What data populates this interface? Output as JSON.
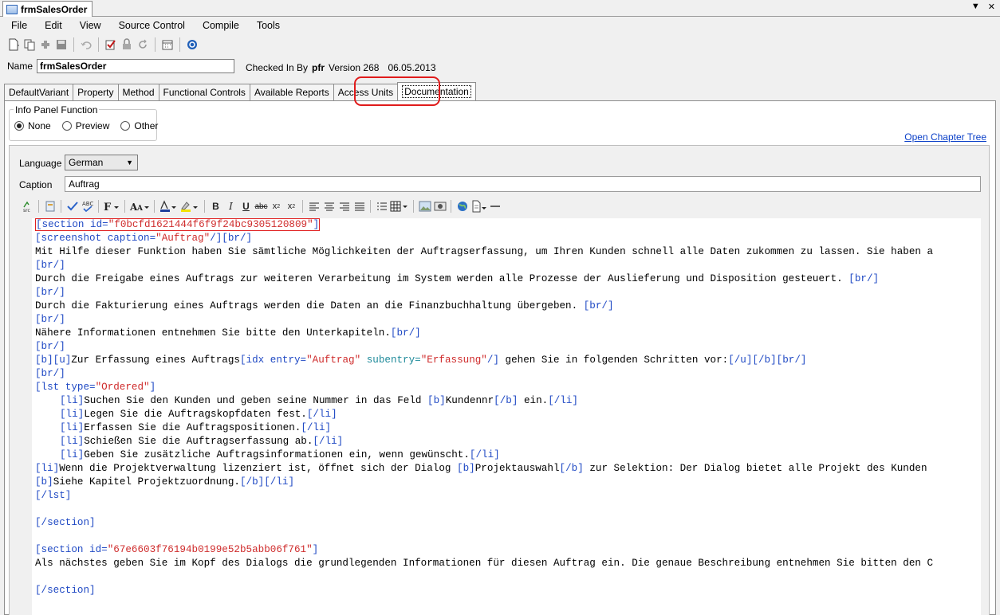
{
  "window": {
    "doc_tab": "frmSalesOrder",
    "tab_dropdown": "▼",
    "tab_close": "✕"
  },
  "menu": [
    "File",
    "Edit",
    "View",
    "Source Control",
    "Compile",
    "Tools"
  ],
  "name_row": {
    "label": "Name",
    "value": "frmSalesOrder",
    "checked_in_by": "Checked In By",
    "user": "pfr",
    "version": "Version 268",
    "date": "06.05.2013"
  },
  "tabs": [
    "DefaultVariant",
    "Property",
    "Method",
    "Functional Controls",
    "Available Reports",
    "Access Units",
    "Documentation"
  ],
  "info_panel": {
    "legend": "Info Panel Function",
    "options": [
      "None",
      "Preview",
      "Other"
    ],
    "selected": "None"
  },
  "open_chapter_tree": "Open Chapter Tree",
  "editor": {
    "language_label": "Language",
    "language_value": "German",
    "caption_label": "Caption",
    "caption_value": "Auftrag"
  },
  "code": {
    "l1a": "[section id=",
    "l1b": "\"f0bcfd1621444f6f9f24bc9305120809\"",
    "l1c": "]",
    "l2a": "[screenshot caption=",
    "l2b": "\"Auftrag\"",
    "l2c": "/][br/]",
    "l3": "Mit Hilfe dieser Funktion haben Sie sämtliche Möglichkeiten der Auftragserfassung, um Ihren Kunden schnell alle Daten zukommen zu lassen. Sie haben a",
    "br": "[br/]",
    "l5a": "Durch die Freigabe eines Auftrags zur weiteren Verarbeitung im System werden alle Prozesse der Auslieferung und Disposition gesteuert. ",
    "l7a": "Durch die Fakturierung eines Auftrags werden die Daten an die Finanzbuchhaltung übergeben. ",
    "l9a": "Nähere Informationen entnehmen Sie bitte den Unterkapiteln.",
    "l11a": "[b][u]",
    "l11b": "Zur Erfassung eines Auftrags",
    "l11c": "[idx entry=",
    "l11d": "\"Auftrag\"",
    "l11e": " subentry=",
    "l11f": "\"Erfassung\"",
    "l11g": "/]",
    "l11h": " gehen Sie in folgenden Schritten vor:",
    "l11i": "[/u][/b][br/]",
    "l13a": "[lst type=",
    "l13b": "\"Ordered\"",
    "l13c": "]",
    "li": "[li]",
    "eli": "[/li]",
    "bo": "[b]",
    "bc": "[/b]",
    "l14a": "Suchen Sie den Kunden und geben seine Nummer in das Feld ",
    "l14b": "Kundennr",
    "l14c": " ein.",
    "l15": "Legen Sie die Auftragskopfdaten fest.",
    "l16": "Erfassen Sie die Auftragspositionen.",
    "l17": "Schießen Sie die Auftragserfassung ab.",
    "l18": "Geben Sie zusätzliche Auftragsinformationen ein, wenn gewünscht.",
    "l19a": "Wenn die Projektverwaltung lizenziert ist, öffnet sich der Dialog ",
    "l19b": "Projektauswahl",
    "l19c": " zur Selektion: Der Dialog bietet alle Projekt des Kunden",
    "l20": "Siehe Kapitel Projektzuordnung.",
    "l21": "[/lst]",
    "l23": "[/section]",
    "l25a": "[section id=",
    "l25b": "\"67e6603f76194b0199e52b5abb06f761\"",
    "l25c": "]",
    "l26": "Als nächstes geben Sie im Kopf des Dialogs die grundlegenden Informationen für diesen Auftrag ein. Die genaue Beschreibung entnehmen Sie bitten den C",
    "l28": "[/section]"
  }
}
